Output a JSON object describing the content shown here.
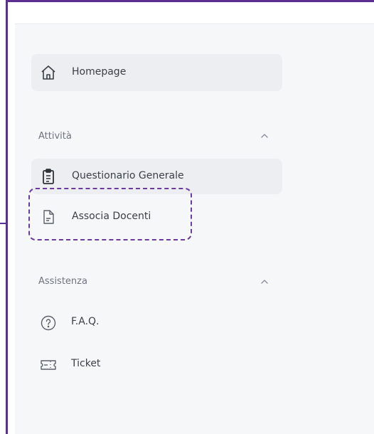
{
  "nav": {
    "homepage": {
      "label": "Homepage",
      "icon": "home-icon"
    },
    "sections": [
      {
        "title": "Attività",
        "items": [
          {
            "label": "Questionario Generale",
            "icon": "clipboard-icon"
          },
          {
            "label": "Associa Docenti",
            "icon": "document-icon"
          }
        ]
      },
      {
        "title": "Assistenza",
        "items": [
          {
            "label": "F.A.Q.",
            "icon": "help-circle-icon"
          },
          {
            "label": "Ticket",
            "icon": "ticket-icon"
          }
        ]
      }
    ]
  },
  "colors": {
    "accent": "#5b2e91",
    "sidebar_bg": "#f6f7f9",
    "active_bg": "#eceef2",
    "text": "#3a3f47",
    "muted": "#6e7480"
  }
}
